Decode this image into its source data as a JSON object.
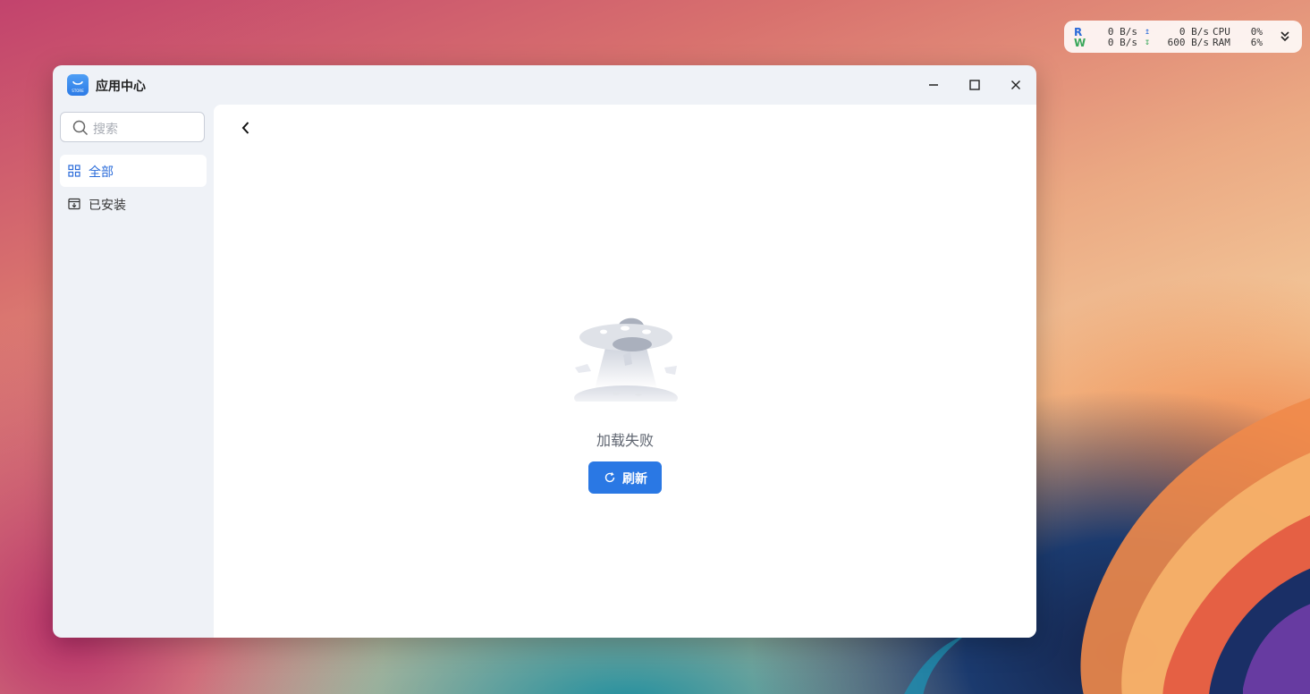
{
  "monitor": {
    "read_label": "R",
    "write_label": "W",
    "read_rate": "0 B/s",
    "write_rate": "0 B/s",
    "upload_rate": "0 B/s",
    "download_rate": "600 B/s",
    "cpu_label": "CPU",
    "ram_label": "RAM",
    "cpu_value": "0%",
    "ram_value": "6%"
  },
  "window": {
    "title": "应用中心",
    "accent_color": "#2a78e4"
  },
  "sidebar": {
    "search_placeholder": "搜索",
    "items": [
      {
        "label": "全部",
        "icon": "grid-icon",
        "active": true
      },
      {
        "label": "已安装",
        "icon": "installed-box-icon",
        "active": false
      }
    ]
  },
  "main": {
    "error_message": "加载失败",
    "refresh_label": "刷新"
  }
}
